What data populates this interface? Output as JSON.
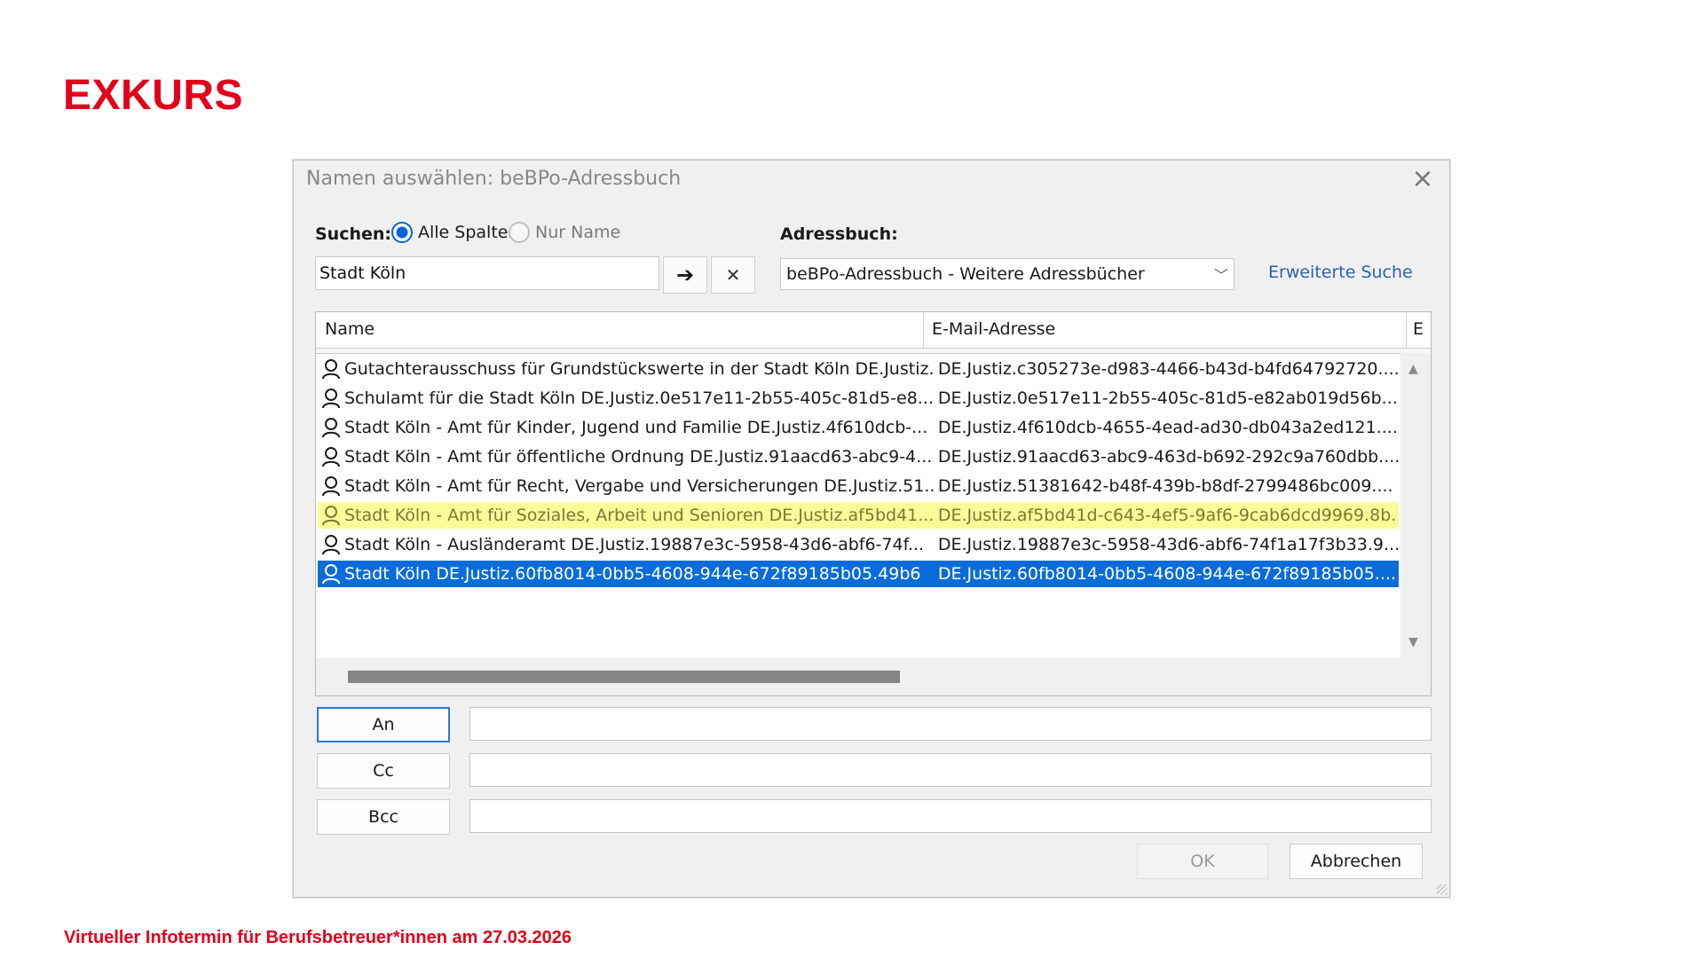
{
  "slide": {
    "title": "EXKURS",
    "footer": "Virtueller Infotermin für Berufsbetreuer*innen am 27.03.2026"
  },
  "dialog": {
    "title": "Namen auswählen: beBPo-Adressbuch",
    "search_label": "Suchen:",
    "radio_all": "Alle Spalten",
    "radio_name": "Nur Name",
    "search_value": "Stadt Köln",
    "go_icon": "➔",
    "clear_icon": "✕",
    "addressbook_label": "Adressbuch:",
    "addressbook_value": "beBPo-Adressbuch - Weitere Adressbücher",
    "advanced_search": "Erweiterte Suche",
    "columns": {
      "name": "Name",
      "email": "E-Mail-Adresse",
      "extra": "E"
    },
    "rows": [
      {
        "name": "Gutachterausschuss für Grundstückswerte in der Stadt Köln DE.Justiz...",
        "email": "DE.Justiz.c305273e-d983-4466-b43d-b4fd64792720...."
      },
      {
        "name": "Schulamt für die Stadt Köln DE.Justiz.0e517e11-2b55-405c-81d5-e8...",
        "email": "DE.Justiz.0e517e11-2b55-405c-81d5-e82ab019d56b..."
      },
      {
        "name": "Stadt Köln - Amt für Kinder, Jugend und Familie DE.Justiz.4f610dcb-...",
        "email": "DE.Justiz.4f610dcb-4655-4ead-ad30-db043a2ed121...."
      },
      {
        "name": "Stadt Köln - Amt für öffentliche Ordnung DE.Justiz.91aacd63-abc9-4...",
        "email": "DE.Justiz.91aacd63-abc9-463d-b692-292c9a760dbb...."
      },
      {
        "name": "Stadt Köln - Amt für Recht, Vergabe und Versicherungen DE.Justiz.51...",
        "email": "DE.Justiz.51381642-b48f-439b-b8df-2799486bc009...."
      },
      {
        "name": "Stadt Köln - Amt für Soziales, Arbeit und Senioren DE.Justiz.af5bd41...",
        "email": "DE.Justiz.af5bd41d-c643-4ef5-9af6-9cab6dcd9969.8b."
      },
      {
        "name": "Stadt Köln - Ausländeramt DE.Justiz.19887e3c-5958-43d6-abf6-74f...",
        "email": "DE.Justiz.19887e3c-5958-43d6-abf6-74f1a17f3b33.9..."
      },
      {
        "name": "Stadt Köln DE.Justiz.60fb8014-0bb5-4608-944e-672f89185b05.49b6",
        "email": "DE.Justiz.60fb8014-0bb5-4608-944e-672f89185b05...."
      }
    ],
    "highlighted_row": 5,
    "selected_row": 7,
    "to_label": "An",
    "cc_label": "Cc",
    "bcc_label": "Bcc",
    "to_value": "",
    "cc_value": "",
    "bcc_value": "",
    "ok_label": "OK",
    "cancel_label": "Abbrechen"
  },
  "colors": {
    "brand_red": "#e2001a",
    "selection_blue": "#0a6cd8",
    "highlight_yellow": "#fbfb9a",
    "link_blue": "#2a62ad"
  }
}
